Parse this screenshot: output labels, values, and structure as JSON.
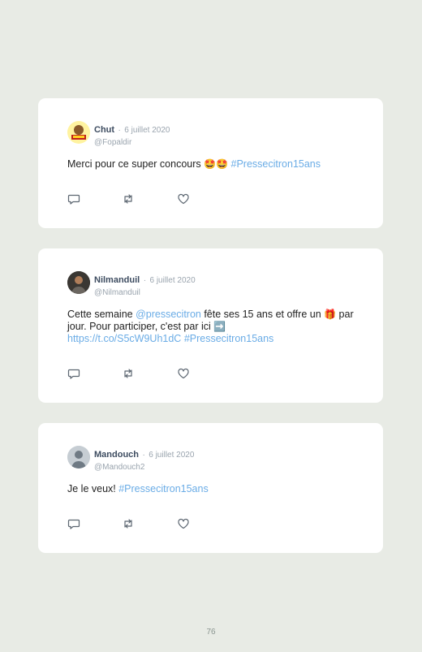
{
  "tweets": [
    {
      "name": "Chut",
      "sep": "·",
      "date": "6 juillet 2020",
      "handle": "@Fopaldir",
      "text_plain": "Merci pour ce super concours ",
      "emoji": "🤩🤩",
      "hashtag": "#Pressecitron15ans"
    },
    {
      "name": "Nilmanduil",
      "sep": "·",
      "date": "6 juillet 2020",
      "handle": "@Nilmanduil",
      "text_a": "Cette semaine ",
      "mention": "@pressecitron",
      "text_b": " fête ses 15 ans et offre un ",
      "gift": "🎁",
      "text_c": " par jour. Pour participer, c'est par ici ",
      "arrow": "➡️",
      "url": "https://t.co/S5cW9Uh1dC",
      "hashtag": "#Pressecitron15ans"
    },
    {
      "name": "Mandouch",
      "sep": "·",
      "date": "6 juillet 2020",
      "handle": "@Mandouch2",
      "text_plain": "Je le veux! ",
      "hashtag": "#Pressecitron15ans"
    }
  ],
  "icons": [
    "reply-icon",
    "retweet-icon",
    "like-icon"
  ],
  "page_number": "76"
}
